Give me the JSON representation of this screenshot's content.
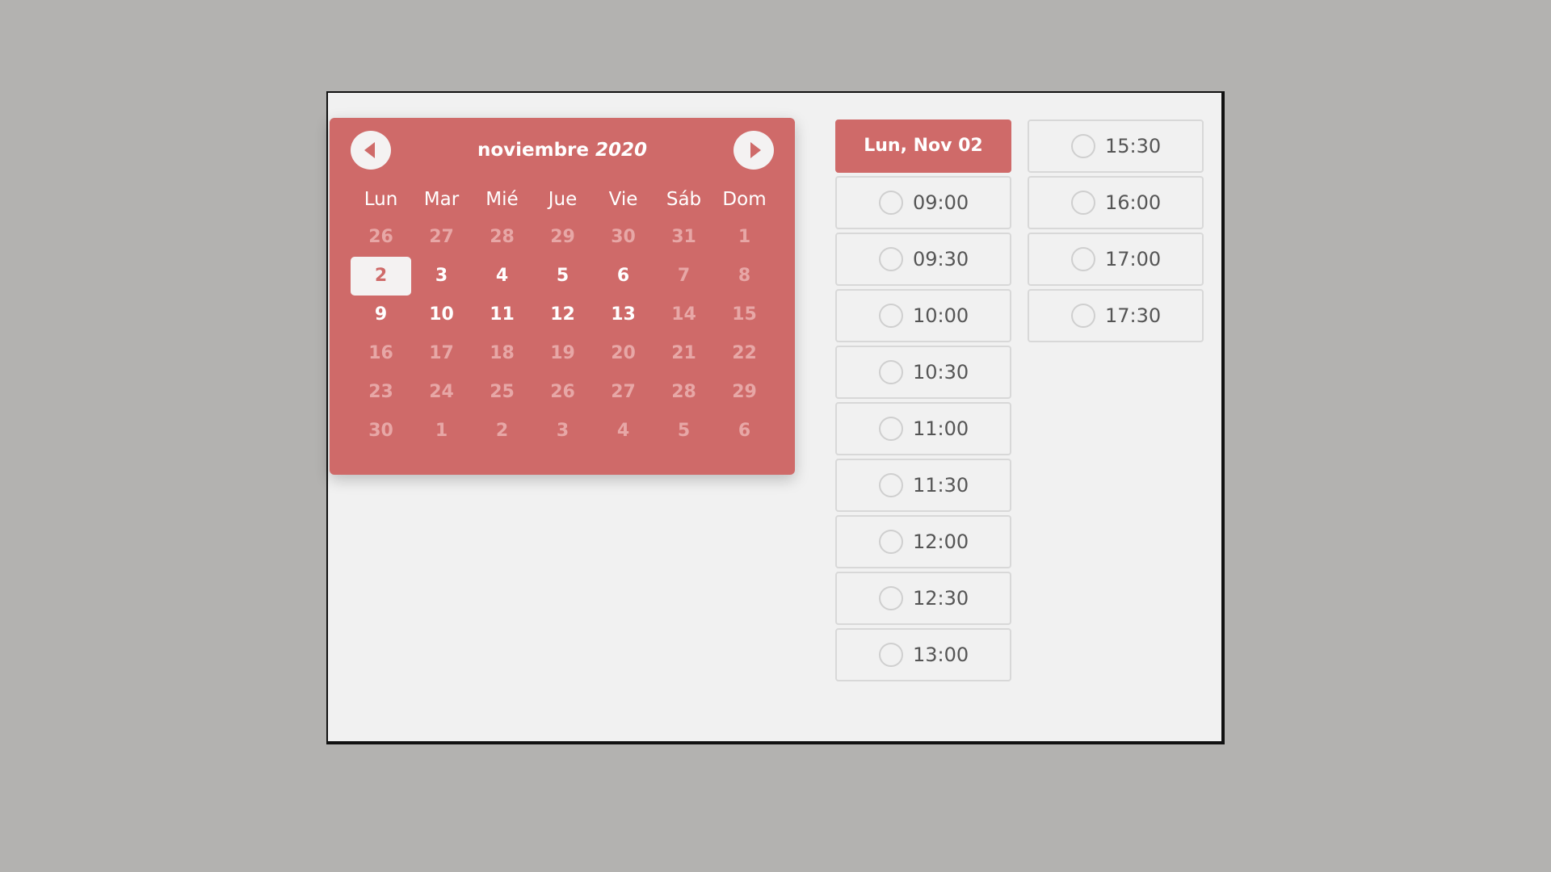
{
  "calendar": {
    "month": "noviembre",
    "year": "2020",
    "weekdays": [
      "Lun",
      "Mar",
      "Mié",
      "Jue",
      "Vie",
      "Sáb",
      "Dom"
    ],
    "days": [
      {
        "label": "26",
        "state": "muted"
      },
      {
        "label": "27",
        "state": "muted"
      },
      {
        "label": "28",
        "state": "muted"
      },
      {
        "label": "29",
        "state": "muted"
      },
      {
        "label": "30",
        "state": "muted"
      },
      {
        "label": "31",
        "state": "muted"
      },
      {
        "label": "1",
        "state": "muted"
      },
      {
        "label": "2",
        "state": "selected"
      },
      {
        "label": "3",
        "state": "active"
      },
      {
        "label": "4",
        "state": "active"
      },
      {
        "label": "5",
        "state": "active"
      },
      {
        "label": "6",
        "state": "active"
      },
      {
        "label": "7",
        "state": "muted"
      },
      {
        "label": "8",
        "state": "muted"
      },
      {
        "label": "9",
        "state": "active"
      },
      {
        "label": "10",
        "state": "active"
      },
      {
        "label": "11",
        "state": "active"
      },
      {
        "label": "12",
        "state": "active"
      },
      {
        "label": "13",
        "state": "active"
      },
      {
        "label": "14",
        "state": "muted"
      },
      {
        "label": "15",
        "state": "muted"
      },
      {
        "label": "16",
        "state": "muted"
      },
      {
        "label": "17",
        "state": "muted"
      },
      {
        "label": "18",
        "state": "muted"
      },
      {
        "label": "19",
        "state": "muted"
      },
      {
        "label": "20",
        "state": "muted"
      },
      {
        "label": "21",
        "state": "muted"
      },
      {
        "label": "22",
        "state": "muted"
      },
      {
        "label": "23",
        "state": "muted"
      },
      {
        "label": "24",
        "state": "muted"
      },
      {
        "label": "25",
        "state": "muted"
      },
      {
        "label": "26",
        "state": "muted"
      },
      {
        "label": "27",
        "state": "muted"
      },
      {
        "label": "28",
        "state": "muted"
      },
      {
        "label": "29",
        "state": "muted"
      },
      {
        "label": "30",
        "state": "muted"
      },
      {
        "label": "1",
        "state": "muted"
      },
      {
        "label": "2",
        "state": "muted"
      },
      {
        "label": "3",
        "state": "muted"
      },
      {
        "label": "4",
        "state": "muted"
      },
      {
        "label": "5",
        "state": "muted"
      },
      {
        "label": "6",
        "state": "muted"
      }
    ],
    "icons": {
      "prev": "chevron-left-icon",
      "next": "chevron-right-icon"
    }
  },
  "slots": {
    "header": "Lun, Nov 02",
    "column1": [
      "09:00",
      "09:30",
      "10:00",
      "10:30",
      "11:00",
      "11:30",
      "12:00",
      "12:30",
      "13:00"
    ],
    "column2": [
      "15:30",
      "16:00",
      "17:00",
      "17:30"
    ]
  },
  "colors": {
    "accent": "#cf6a69",
    "background": "#b3b2b0",
    "panel": "#f1f1f1"
  }
}
